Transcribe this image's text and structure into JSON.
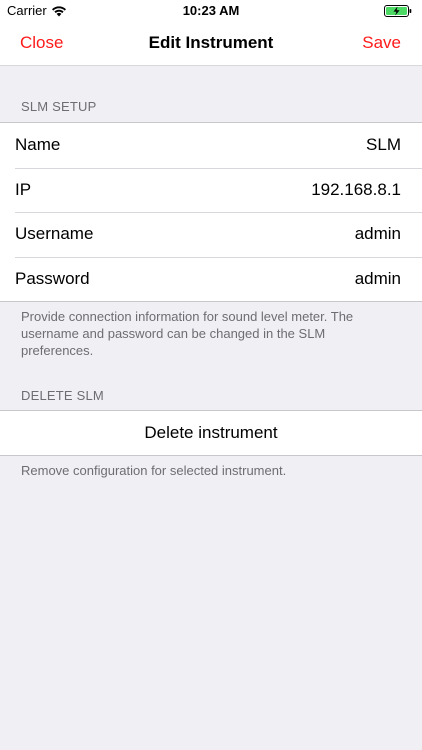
{
  "status_bar": {
    "carrier": "Carrier",
    "time": "10:23 AM",
    "battery_color": "#4cd964"
  },
  "nav": {
    "close_label": "Close",
    "title": "Edit Instrument",
    "save_label": "Save",
    "tint_color": "#ff1a1a"
  },
  "slm_setup": {
    "header": "SLM SETUP",
    "rows": [
      {
        "label": "Name",
        "value": "SLM"
      },
      {
        "label": "IP",
        "value": "192.168.8.1"
      },
      {
        "label": "Username",
        "value": "admin"
      },
      {
        "label": "Password",
        "value": "admin"
      }
    ],
    "footer": "Provide connection information for sound level meter. The username and password can be changed in the SLM preferences."
  },
  "delete_slm": {
    "header": "DELETE SLM",
    "button_label": "Delete instrument",
    "footer": "Remove configuration for selected instrument."
  },
  "icons": {
    "wifi": "wifi-icon",
    "battery": "battery-charging-icon"
  }
}
